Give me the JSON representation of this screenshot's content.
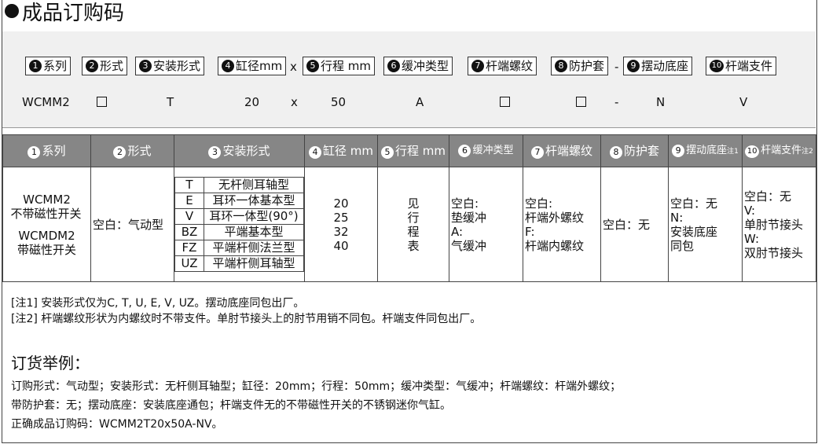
{
  "title": "成品订购码",
  "code_items": [
    {
      "num": "1",
      "label": "系列"
    },
    {
      "num": "2",
      "label": "形式"
    },
    {
      "num": "3",
      "label": "安装形式"
    },
    {
      "num": "4",
      "label": "缸径mm"
    },
    {
      "num": "5",
      "label": "行程 mm"
    },
    {
      "num": "6",
      "label": "缓冲类型"
    },
    {
      "num": "7",
      "label": "杆端螺纹"
    },
    {
      "num": "8",
      "label": "防护套"
    },
    {
      "num": "9",
      "label": "摆动底座"
    },
    {
      "num": "10",
      "label": "杆端支件"
    }
  ],
  "code_separators": {
    "x": "x",
    "dash": "-"
  },
  "example_row": {
    "series": "WCMM2",
    "mount": "T",
    "bore": "20",
    "x": "x",
    "stroke": "50",
    "cushion": "A",
    "dash": "-",
    "base": "N",
    "rod_support": "V"
  },
  "table": {
    "headers": [
      {
        "num": "1",
        "label": "系列"
      },
      {
        "num": "2",
        "label": "形式"
      },
      {
        "num": "3",
        "label": "安装形式"
      },
      {
        "num": "4",
        "label": "缸径 mm"
      },
      {
        "num": "5",
        "label": "行程 mm"
      },
      {
        "num": "6",
        "label": "缓冲类型"
      },
      {
        "num": "7",
        "label": "杆端螺纹"
      },
      {
        "num": "8",
        "label": "防护套"
      },
      {
        "num": "9",
        "label": "摆动底座",
        "note": "注1"
      },
      {
        "num": "10",
        "label": "杆端支件",
        "note": "注2"
      }
    ],
    "series": [
      "WCMM2",
      "不带磁性开关",
      "WCMDM2",
      "带磁性开关"
    ],
    "type": "空白：气动型",
    "mounts": [
      {
        "code": "T",
        "name": "无杆侧耳轴型"
      },
      {
        "code": "E",
        "name": "耳环一体基本型"
      },
      {
        "code": "V",
        "name": "耳环一体型(90°)"
      },
      {
        "code": "BZ",
        "name": "平端基本型"
      },
      {
        "code": "FZ",
        "name": "平端杆侧法兰型"
      },
      {
        "code": "UZ",
        "name": "平端杆侧耳轴型"
      }
    ],
    "bores": [
      "20",
      "25",
      "32",
      "40"
    ],
    "stroke": "见行程表",
    "cushion": [
      "空白:",
      "垫缓冲",
      "A:",
      "气缓冲"
    ],
    "rod_thread": [
      "空白:",
      "杆端外螺纹",
      "F:",
      "杆端内螺纹"
    ],
    "boot": "空白：无",
    "base": [
      "空白：无",
      "N:",
      "安装底座",
      "同包"
    ],
    "rod_support": [
      "空白：无",
      "V:",
      "单肘节接头",
      "W:",
      "双肘节接头"
    ]
  },
  "notes": [
    "[注1] 安装形式仅为C, T, U, E, V, UZ。摆动底座同包出厂。",
    "[注2] 杆端螺纹形状为内螺纹时不带支件。单肘节接头上的肘节用销不同包。杆端支件同包出厂。"
  ],
  "order_example": {
    "heading": "订货举例：",
    "lines": [
      "订购形式：气动型；安装形式：无杆侧耳轴型；缸径：20mm；行程：50mm；缓冲类型：气缓冲；杆端螺纹：杆端外螺纹；",
      "带防护套：无；摆动底座：安装底座通包；杆端支件无的不带磁性开关的不锈钢迷你气缸。",
      "正确成品订购码：WCMM2T20x50A-NV。"
    ]
  }
}
